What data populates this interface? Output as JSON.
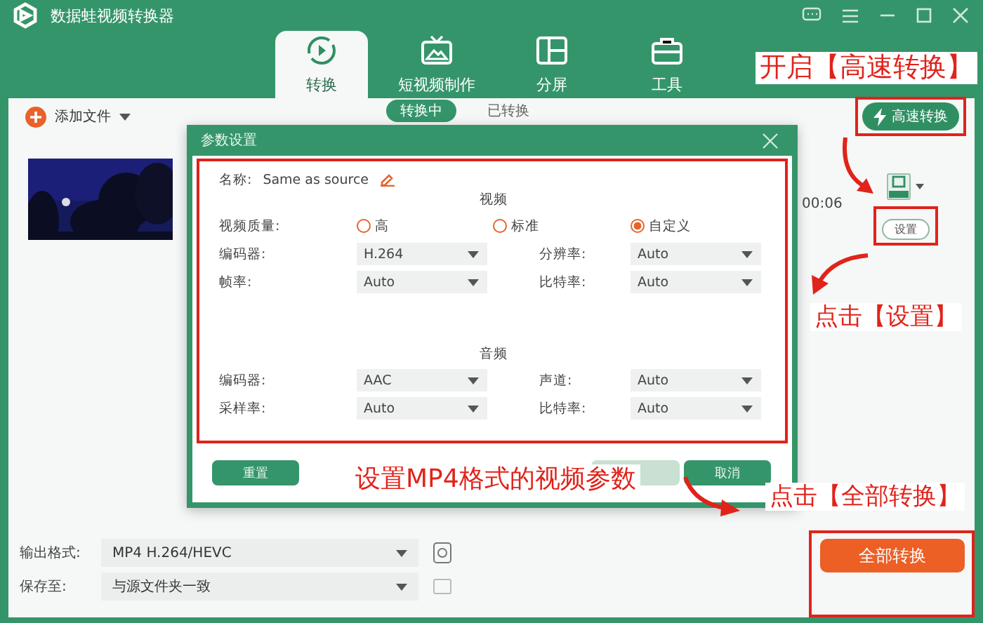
{
  "app": {
    "title": "数据蛙视频转换器"
  },
  "tabs": [
    {
      "label": "转换",
      "selected": true,
      "kind": "convert"
    },
    {
      "label": "短视频制作",
      "selected": false,
      "kind": "video"
    },
    {
      "label": "分屏",
      "selected": false,
      "kind": "split"
    },
    {
      "label": "工具",
      "selected": false,
      "kind": "tools"
    }
  ],
  "toolbar": {
    "add_file": "添加文件",
    "fast_convert": "高速转换"
  },
  "subtabs": [
    {
      "label": "转换中",
      "selected": true
    },
    {
      "label": "已转换",
      "selected": false
    }
  ],
  "file": {
    "duration": "00:06",
    "settings_button": "设置"
  },
  "dialog": {
    "title": "参数设置",
    "name_label": "名称:",
    "name_value": "Same as source",
    "video_heading": "视频",
    "quality_label": "视频质量:",
    "quality_options": [
      {
        "label": "高",
        "selected": false
      },
      {
        "label": "标准",
        "selected": false
      },
      {
        "label": "自定义",
        "selected": true
      }
    ],
    "video_fields": [
      {
        "label": "编码器:",
        "value": "H.264"
      },
      {
        "label": "分辨率:",
        "value": "Auto"
      },
      {
        "label": "帧率:",
        "value": "Auto"
      },
      {
        "label": "比特率:",
        "value": "Auto"
      }
    ],
    "audio_heading": "音频",
    "audio_fields": [
      {
        "label": "编码器:",
        "value": "AAC"
      },
      {
        "label": "声道:",
        "value": "Auto"
      },
      {
        "label": "采样率:",
        "value": "Auto"
      },
      {
        "label": "比特率:",
        "value": "Auto"
      }
    ],
    "reset_button": "重置",
    "cancel_button": "取消"
  },
  "bottom": {
    "output_label": "输出格式:",
    "output_value": "MP4 H.264/HEVC",
    "save_label": "保存至:",
    "save_value": "与源文件夹一致",
    "convert_all": "全部转换"
  },
  "annotations": [
    {
      "text": "开启【高速转换】"
    },
    {
      "text": "点击【设置】"
    },
    {
      "text": "设置MP4格式的视频参数"
    },
    {
      "text": "点击【全部转换】"
    }
  ]
}
